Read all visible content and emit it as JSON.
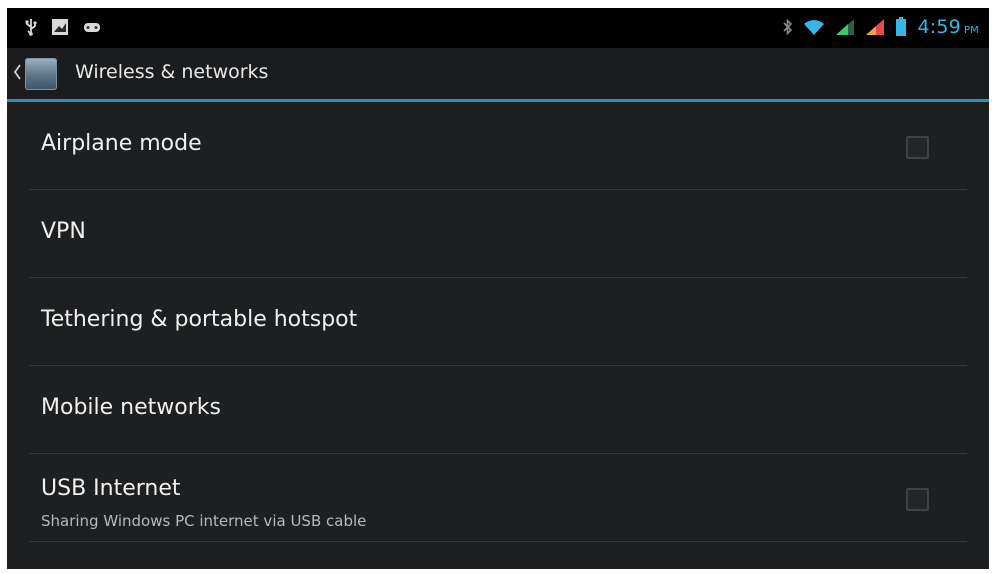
{
  "statusbar": {
    "left_icons": [
      "usb-icon",
      "image-notification-icon",
      "gamepad-icon"
    ],
    "right_icons": [
      "bluetooth-icon",
      "wifi-icon",
      "signal-icon",
      "signal-icon",
      "battery-icon"
    ],
    "time": "4:59",
    "ampm": "PM"
  },
  "actionbar": {
    "title": "Wireless & networks"
  },
  "settings": {
    "items": [
      {
        "label": "Airplane mode",
        "has_checkbox": true,
        "checked": false
      },
      {
        "label": "VPN"
      },
      {
        "label": "Tethering & portable hotspot"
      },
      {
        "label": "Mobile networks"
      },
      {
        "label": "USB Internet",
        "summary": "Sharing Windows PC internet via USB cable",
        "has_checkbox": true,
        "checked": false
      }
    ]
  },
  "colors": {
    "accent": "#35b6e6",
    "background": "#1d1f21",
    "statusbar": "#000000",
    "divider": "#34373a"
  }
}
